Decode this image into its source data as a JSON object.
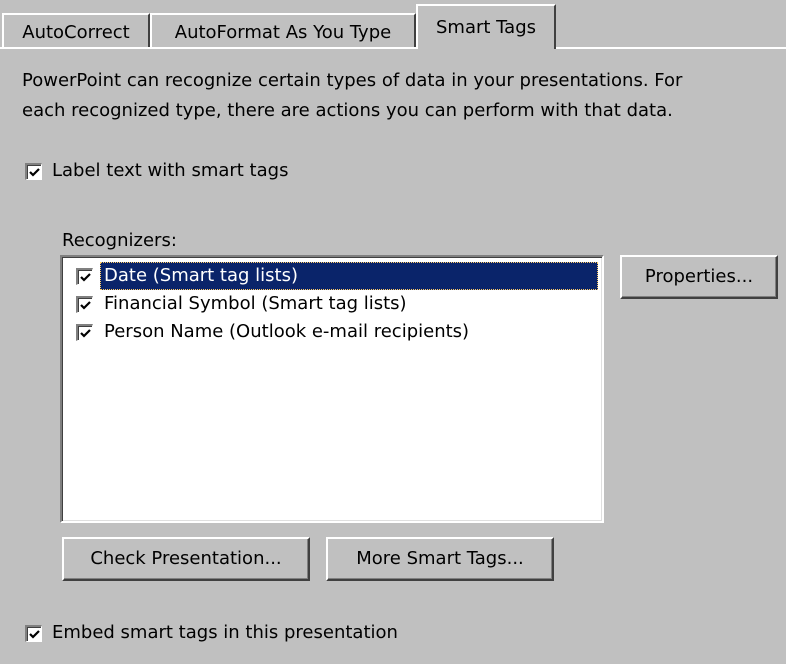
{
  "tabs": [
    {
      "label": "AutoCorrect",
      "active": false
    },
    {
      "label": "AutoFormat As You Type",
      "active": false
    },
    {
      "label": "Smart Tags",
      "active": true
    }
  ],
  "description": {
    "line1": "PowerPoint can recognize certain types of data in your presentations. For",
    "line2": "each recognized type, there are actions you can perform with that data."
  },
  "label_text_checkbox": {
    "label": "Label text with smart tags",
    "checked": true
  },
  "recognizers": {
    "label": "Recognizers:",
    "items": [
      {
        "label": "Date (Smart tag lists)",
        "checked": true,
        "selected": true
      },
      {
        "label": "Financial Symbol (Smart tag lists)",
        "checked": true,
        "selected": false
      },
      {
        "label": "Person Name (Outlook e-mail recipients)",
        "checked": true,
        "selected": false
      }
    ]
  },
  "buttons": {
    "properties": "Properties...",
    "check_presentation": "Check Presentation...",
    "more_smart_tags": "More Smart Tags..."
  },
  "embed_checkbox": {
    "label": "Embed smart tags in this presentation",
    "checked": true
  },
  "colors": {
    "dialog_bg": "#c0c0c0",
    "selection_bg": "#0a246a",
    "selection_text": "#ffffff"
  }
}
